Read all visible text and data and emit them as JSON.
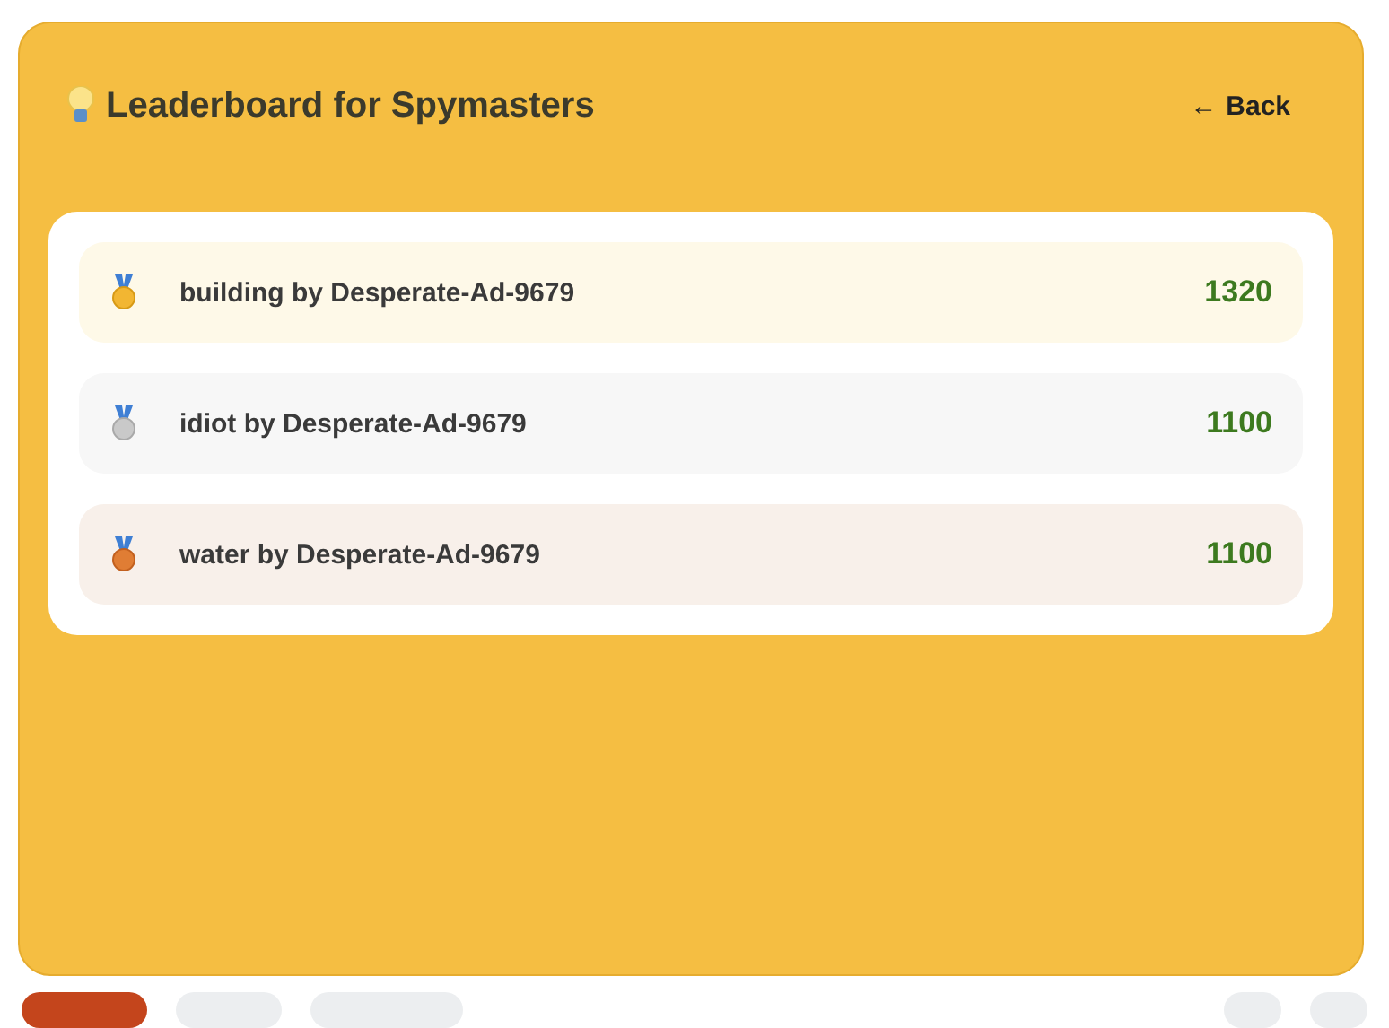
{
  "header": {
    "title": "Leaderboard for Spymasters",
    "back_button": {
      "arrow": "←",
      "label": "Back"
    }
  },
  "entries": [
    {
      "kind": "gold",
      "name": "building by Desperate-Ad-9679",
      "score": "1320"
    },
    {
      "kind": "silver",
      "name": "idiot by Desperate-Ad-9679",
      "score": "1100"
    },
    {
      "kind": "bronze",
      "name": "water by Desperate-Ad-9679",
      "score": "1100"
    }
  ],
  "bottom_bar": [
    {
      "kind": "primary"
    },
    {
      "kind": "pill"
    },
    {
      "kind": "wide-pill"
    },
    {
      "kind": "spacer"
    },
    {
      "kind": "round"
    },
    {
      "kind": "round"
    }
  ]
}
